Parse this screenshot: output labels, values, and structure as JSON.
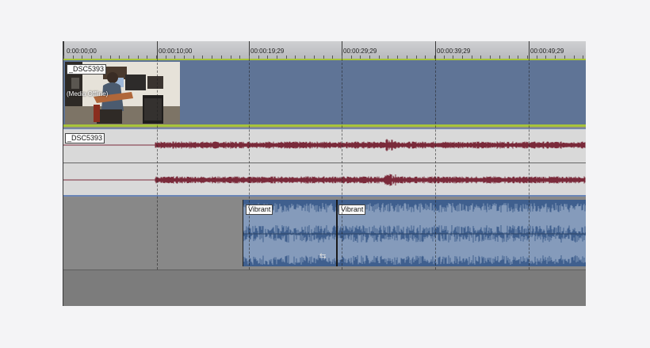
{
  "ruler": {
    "labels": [
      "0:00:00;00",
      "00:00:10;00",
      "00:00:19;29",
      "00:00:29;29",
      "00:00:39;29",
      "00:00:49;29"
    ]
  },
  "video_track": {
    "clip_label": "_DSC5393",
    "overlay_text": "(Media Offline)"
  },
  "audio_track": {
    "clip_label": "_DSC5393"
  },
  "music_track": {
    "clip1_label": "Vibrant",
    "clip2_label": "Vibrant"
  },
  "colors": {
    "video_bg": "#5f7496",
    "audio_waveform": "#7a2a3a",
    "music_clip": "#3f5f8e",
    "track_border": "#a8c43a"
  }
}
